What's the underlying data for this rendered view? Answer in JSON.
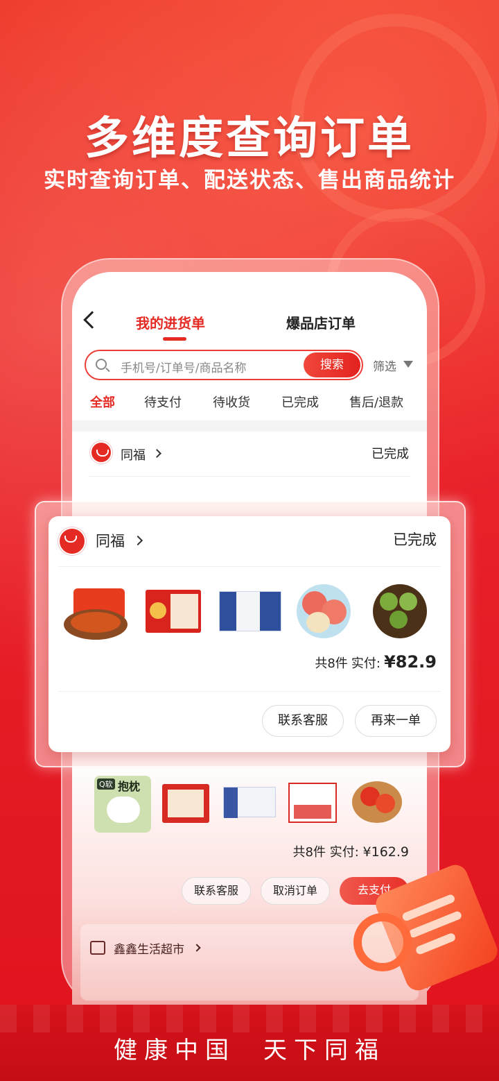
{
  "headline": "多维度查询订单",
  "subline": "实时查询订单、配送状态、售出商品统计",
  "nav": {
    "tab_active": "我的进货单",
    "tab_other": "爆品店订单"
  },
  "search": {
    "placeholder": "手机号/订单号/商品名称",
    "button": "搜索",
    "filter": "筛选"
  },
  "status_tabs": [
    "全部",
    "待支付",
    "待收货",
    "已完成",
    "售后/退款"
  ],
  "order_card_bg": {
    "shop": "同福",
    "status": "已完成"
  },
  "order_card_float": {
    "shop": "同福",
    "status": "已完成",
    "count_label": "共8件",
    "paid_label": "实付:",
    "amount": "¥82.9",
    "btn_service": "联系客服",
    "btn_reorder": "再来一单",
    "products": [
      "辣炒年糕",
      "同福八宝粥礼盒",
      "牛奶礼盒",
      "苹果",
      "抱子甘蓝"
    ]
  },
  "order_card_pending": {
    "count_label": "共8件",
    "paid_label": "实付:",
    "amount": "¥162.9",
    "btn_service": "联系客服",
    "btn_cancel": "取消订单",
    "btn_pay": "去支付",
    "products": [
      "Q软抱枕",
      "同福八宝粥礼盒",
      "牛奶礼盒",
      "同福礼盒",
      "番茄"
    ],
    "pillow_text": "抱枕",
    "pillow_badge": "Q软"
  },
  "next_shop": "鑫鑫生活超市",
  "slogan_left": "健康中国",
  "slogan_right": "天下同福",
  "colors": {
    "brand_red": "#e52a24",
    "background": "#e8161f"
  }
}
